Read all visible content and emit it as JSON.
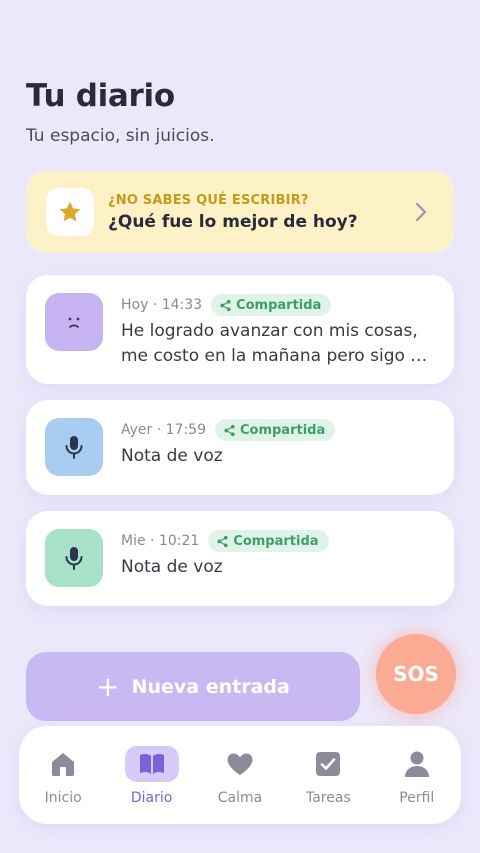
{
  "header": {
    "title": "Tu diario",
    "subtitle": "Tu espacio, sin juicios."
  },
  "prompt": {
    "kicker": "¿NO SABES QUÉ ESCRIBIR?",
    "question": "¿Qué fue lo mejor de hoy?",
    "icon": "star-icon",
    "chevron": "chevron-right-icon"
  },
  "entries": [
    {
      "time": "Hoy · 14:33",
      "badge": "Compartida",
      "icon": "sad-face-icon",
      "icon_bg": "#c6b4f2",
      "line1": "He logrado avanzar con mis cosas,",
      "line2": "me costo en la mañana pero sigo de ..."
    },
    {
      "time": "Ayer · 17:59",
      "badge": "Compartida",
      "icon": "microphone-icon",
      "icon_bg": "#a9cdf1",
      "line1": "Nota de voz"
    },
    {
      "time": "Mie · 10:21",
      "badge": "Compartida",
      "icon": "microphone-icon",
      "icon_bg": "#a6e1c8",
      "line1": "Nota de voz"
    }
  ],
  "actions": {
    "new_entry": "Nueva entrada",
    "sos": "SOS"
  },
  "tabs": [
    {
      "label": "Inicio",
      "icon": "home-icon",
      "active": false
    },
    {
      "label": "Diario",
      "icon": "book-icon",
      "active": true
    },
    {
      "label": "Calma",
      "icon": "heart-icon",
      "active": false
    },
    {
      "label": "Tareas",
      "icon": "checkbox-icon",
      "active": false
    },
    {
      "label": "Perfil",
      "icon": "user-icon",
      "active": false
    }
  ],
  "colors": {
    "background": "#ece8fb",
    "accent": "#7a62d8",
    "prompt_bg": "#fdf1c7",
    "badge_bg": "#dff3e8",
    "badge_text": "#3e9e6a",
    "sos": "#fbaa94",
    "new_entry": "#c9b9f3"
  }
}
